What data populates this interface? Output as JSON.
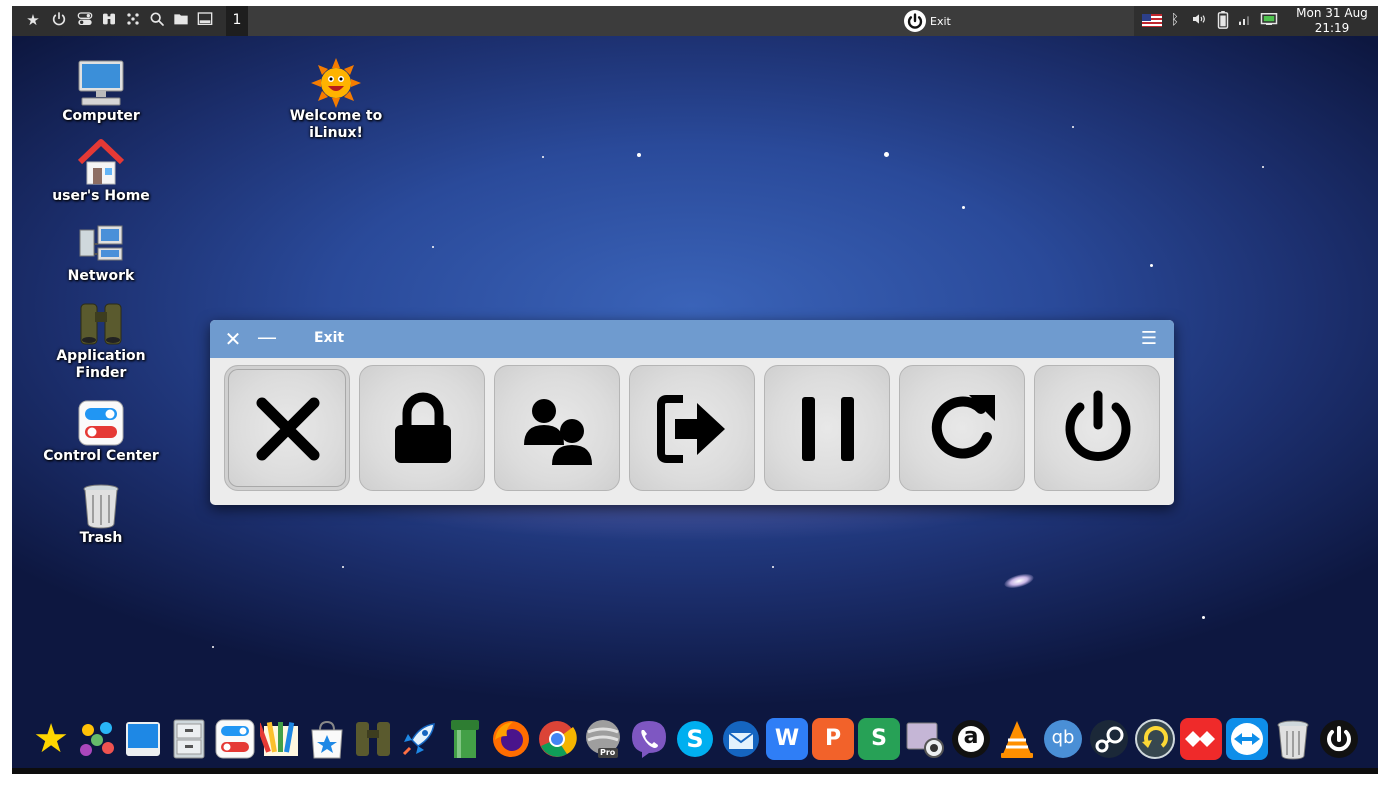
{
  "top_panel": {
    "workspace": "1",
    "task": {
      "label": "Exit",
      "icon": "power-icon"
    },
    "clock": {
      "date": "Mon 31 Aug",
      "time": "21:19"
    },
    "left_icons": [
      "star-icon",
      "power-icon",
      "toggle-icon",
      "binoculars-icon",
      "apps-grid-icon",
      "search-icon",
      "folder-icon",
      "show-desktop-icon"
    ],
    "tray_icons": [
      "us-flag-icon",
      "bluetooth-icon",
      "volume-icon",
      "battery-icon",
      "signal-icon",
      "network-icon"
    ]
  },
  "desktop_icons": [
    {
      "label": "Computer",
      "icon": "computer-icon"
    },
    {
      "label": "user's Home",
      "icon": "home-icon"
    },
    {
      "label": "Network",
      "icon": "network-icon"
    },
    {
      "label": "Application Finder",
      "icon": "binoculars-icon"
    },
    {
      "label": "Control Center",
      "icon": "control-center-icon"
    },
    {
      "label": "Trash",
      "icon": "trash-icon"
    },
    {
      "label": "Welcome to iLinux!",
      "icon": "sun-icon"
    }
  ],
  "dialog": {
    "title": "Exit",
    "buttons": [
      {
        "icon": "cancel-x-icon",
        "focused": true
      },
      {
        "icon": "lock-icon"
      },
      {
        "icon": "switch-user-icon"
      },
      {
        "icon": "logout-icon"
      },
      {
        "icon": "suspend-icon"
      },
      {
        "icon": "restart-icon"
      },
      {
        "icon": "shutdown-icon"
      }
    ]
  },
  "dock": {
    "items": [
      "star",
      "apps-grid",
      "desktop",
      "file-cabinet",
      "control-center",
      "color-palette",
      "app-store",
      "binoculars",
      "rocket",
      "green-pipe",
      "firefox",
      "chrome",
      "google-earth-pro",
      "viber",
      "skype",
      "thunderbird",
      "wps-writer",
      "wps-presentation",
      "wps-spreadsheet",
      "webcam",
      "amazon",
      "vlc",
      "qbittorrent",
      "steam",
      "timeshift",
      "anydesk",
      "teamviewer",
      "trash",
      "power"
    ],
    "labels": {
      "wps-writer": "W",
      "wps-presentation": "P",
      "wps-spreadsheet": "S",
      "skype": "S",
      "qbittorrent": "qb",
      "amazon": "a",
      "google-earth-pro": "Pro"
    }
  },
  "colors": {
    "panel": "#2f2f2f",
    "titlebar": "#6f9bcf",
    "dialog_bg": "#ececec"
  }
}
